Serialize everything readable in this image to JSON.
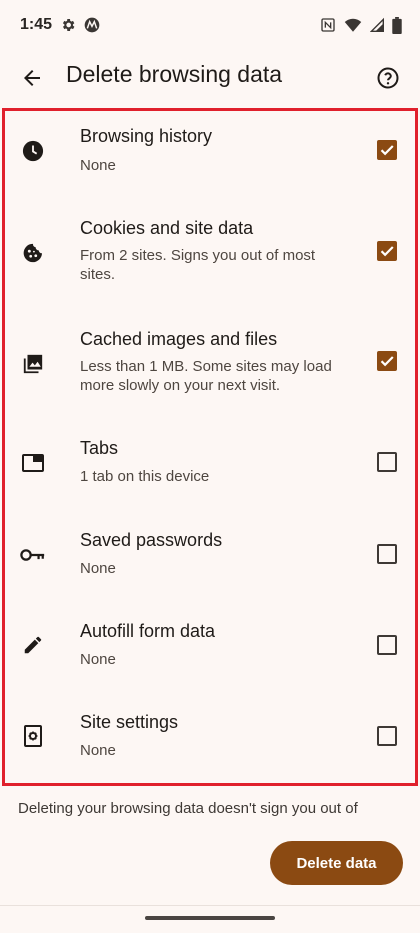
{
  "status_bar": {
    "time": "1:45",
    "left_icons": [
      "gear-icon",
      "motorola-icon"
    ],
    "right_icons": [
      "nfc-icon",
      "wifi-icon",
      "signal-icon",
      "battery-icon"
    ]
  },
  "header": {
    "title": "Delete browsing data",
    "back_icon": "arrow-left-icon",
    "help_icon": "help-circle-icon"
  },
  "items": [
    {
      "title": "Browsing history",
      "subtitle": "None",
      "icon": "clock-icon",
      "checked": true
    },
    {
      "title": "Cookies and site data",
      "subtitle": "From 2 sites. Signs you out of most sites.",
      "icon": "cookie-icon",
      "checked": true
    },
    {
      "title": "Cached images and files",
      "subtitle": "Less than 1 MB. Some sites may load more slowly on your next visit.",
      "icon": "images-icon",
      "checked": true
    },
    {
      "title": "Tabs",
      "subtitle": "1 tab on this device",
      "icon": "tab-icon",
      "checked": false
    },
    {
      "title": "Saved passwords",
      "subtitle": "None",
      "icon": "key-icon",
      "checked": false
    },
    {
      "title": "Autofill form data",
      "subtitle": "None",
      "icon": "pencil-icon",
      "checked": false
    },
    {
      "title": "Site settings",
      "subtitle": "None",
      "icon": "site-settings-icon",
      "checked": false
    }
  ],
  "footer": {
    "note": "Deleting your browsing data doesn't sign you out of",
    "delete_button": "Delete data"
  },
  "colors": {
    "accent": "#8b4a12",
    "highlight_border": "#e0202c",
    "background": "#fdf7f4"
  }
}
